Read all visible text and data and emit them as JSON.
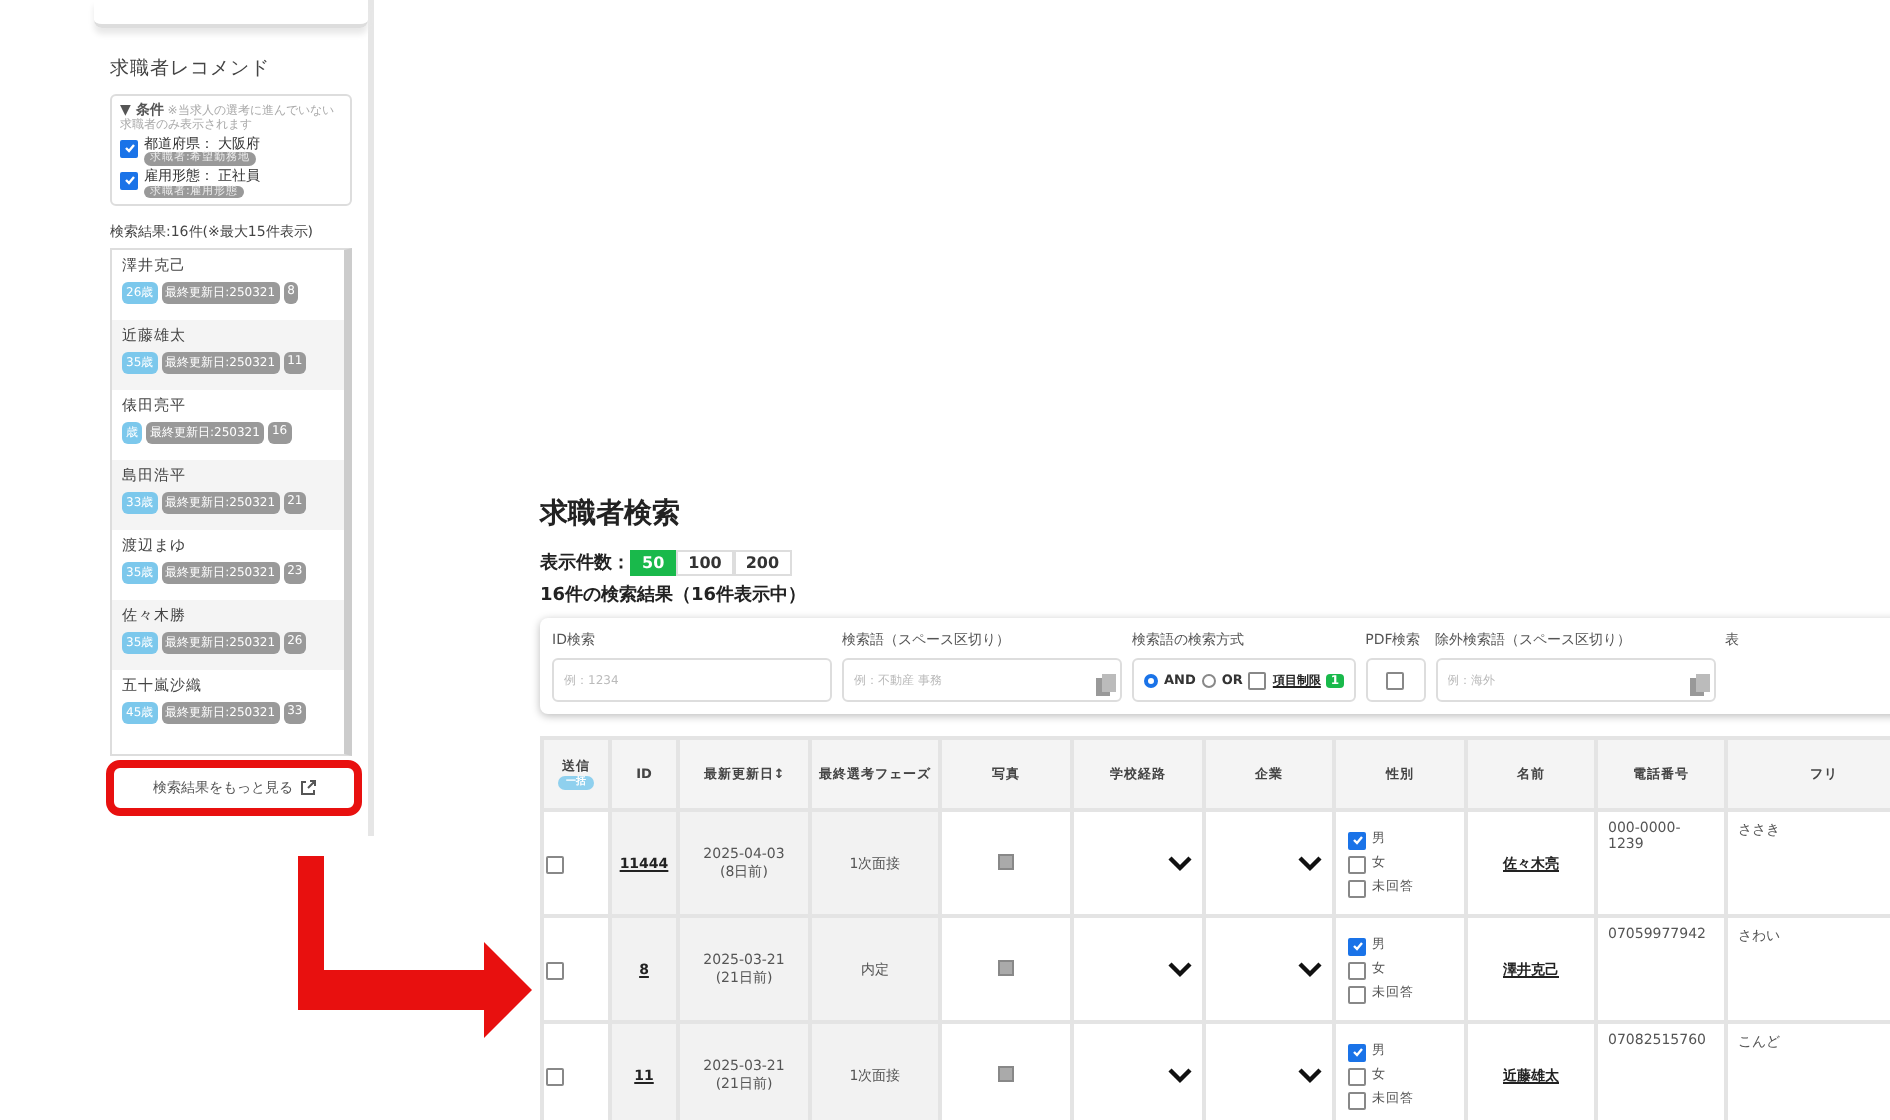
{
  "recommend_panel": {
    "title": "求職者レコメンド",
    "condition": {
      "heading": "▼ 条件",
      "note": "※当求人の選考に進んでいない求職者のみ表示されます",
      "items": [
        {
          "label": "都道府県：",
          "value": "大阪府",
          "tag": "求職者:希望勤務地",
          "checked": true
        },
        {
          "label": "雇用形態：",
          "value": "正社員",
          "tag": "求職者:雇用形態",
          "checked": true
        }
      ]
    },
    "result_summary": "検索結果:16件(※最大15件表示)",
    "candidates": [
      {
        "name": "澤井克己",
        "age": "26歳",
        "updated": "最終更新日:250321",
        "id": "8"
      },
      {
        "name": "近藤雄太",
        "age": "35歳",
        "updated": "最終更新日:250321",
        "id": "11"
      },
      {
        "name": "俵田亮平",
        "age": "歳",
        "updated": "最終更新日:250321",
        "id": "16"
      },
      {
        "name": "島田浩平",
        "age": "33歳",
        "updated": "最終更新日:250321",
        "id": "21"
      },
      {
        "name": "渡辺まゆ",
        "age": "35歳",
        "updated": "最終更新日:250321",
        "id": "23"
      },
      {
        "name": "佐々木勝",
        "age": "35歳",
        "updated": "最終更新日:250321",
        "id": "26"
      },
      {
        "name": "五十嵐沙織",
        "age": "45歳",
        "updated": "最終更新日:250321",
        "id": "33"
      }
    ],
    "more_link": "検索結果をもっと見る"
  },
  "page_title": "求職者検索",
  "page_size": {
    "label": "表示件数：",
    "options": [
      {
        "label": "50",
        "selected": true
      },
      {
        "label": "100",
        "selected": false
      },
      {
        "label": "200",
        "selected": false
      }
    ]
  },
  "result_count": "16件の検索結果（16件表示中）",
  "filters": {
    "id_search": {
      "label": "ID検索",
      "placeholder": "例：1234"
    },
    "keyword": {
      "label": "検索語（スペース区切り）",
      "placeholder": "例：不動産 事務"
    },
    "match_mode": {
      "label": "検索語の検索方式",
      "options": [
        {
          "label": "AND",
          "selected": true
        },
        {
          "label": "OR",
          "selected": false
        }
      ],
      "field_limit": {
        "label": "項目制限",
        "checked": false,
        "count": "1"
      }
    },
    "pdf": {
      "label": "PDF検索",
      "checked": false
    },
    "exclude": {
      "label": "除外検索語（スペース区切り）",
      "placeholder": "例：海外"
    },
    "column_6": {
      "label": "表"
    }
  },
  "table": {
    "columns": [
      {
        "label": "送信",
        "badge": "一括"
      },
      {
        "label": "ID"
      },
      {
        "label": "最新更新日↕"
      },
      {
        "label": "最終選考フェーズ"
      },
      {
        "label": "写真"
      },
      {
        "label": "学校経路"
      },
      {
        "label": "企業"
      },
      {
        "label": "性別"
      },
      {
        "label": "名前"
      },
      {
        "label": "電話番号"
      },
      {
        "label": "フリ"
      }
    ],
    "rows": [
      {
        "selected": false,
        "id": "11444",
        "date": "2025-04-03",
        "ago": "(8日前)",
        "phase": "1次面接",
        "gender": [
          {
            "label": "男",
            "checked": true
          },
          {
            "label": "女",
            "checked": false
          },
          {
            "label": "未回答",
            "checked": false
          }
        ],
        "name": "佐々木亮",
        "phone": "000-0000-1239",
        "kana": "ささき"
      },
      {
        "selected": false,
        "id": "8",
        "date": "2025-03-21",
        "ago": "(21日前)",
        "phase": "内定",
        "gender": [
          {
            "label": "男",
            "checked": true
          },
          {
            "label": "女",
            "checked": false
          },
          {
            "label": "未回答",
            "checked": false
          }
        ],
        "name": "澤井克己",
        "phone": "07059977942",
        "kana": "さわい"
      },
      {
        "selected": false,
        "id": "11",
        "date": "2025-03-21",
        "ago": "(21日前)",
        "phase": "1次面接",
        "gender": [
          {
            "label": "男",
            "checked": true
          },
          {
            "label": "女",
            "checked": false
          },
          {
            "label": "未回答",
            "checked": false
          }
        ],
        "name": "近藤雄太",
        "phone": "07082515760",
        "kana": "こんど"
      }
    ]
  }
}
